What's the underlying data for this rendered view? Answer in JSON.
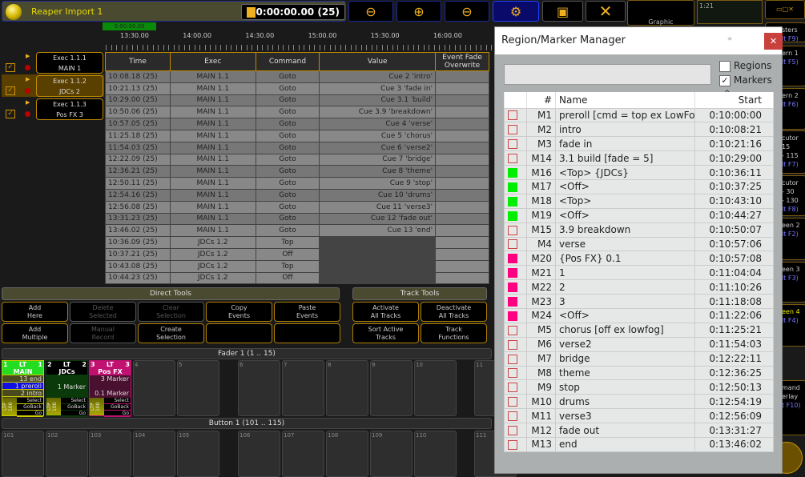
{
  "header": {
    "title": "Reaper Import 1",
    "timecode": "0:00:00.00 (25)",
    "graphic_label": "Graphic",
    "mini_label": "1:21"
  },
  "toolbar": [
    "zoom-out-icon",
    "zoom-in-icon",
    "zoom-fit-icon",
    "settings-icon",
    "view-icon",
    "close-icon"
  ],
  "timeline": {
    "playhead": "0:00:00.00",
    "labels": [
      "13:30.00",
      "14:00.00",
      "14:30.00",
      "15:00.00",
      "15:30.00",
      "16:00.00"
    ]
  },
  "tracks": [
    {
      "exec": "Exec 1.1.1",
      "name": "MAIN 1",
      "selected": false
    },
    {
      "exec": "Exec 1.1.2",
      "name": "JDCs 2",
      "selected": true
    },
    {
      "exec": "Exec 1.1.3",
      "name": "Pos FX 3",
      "selected": false
    }
  ],
  "events": {
    "headers": [
      "Time",
      "Exec",
      "Command",
      "Value",
      "Event Fade Overwrite"
    ],
    "rows": [
      [
        "10:08.18 (25)",
        "MAIN 1.1",
        "Goto",
        "Cue 2 'intro'"
      ],
      [
        "10:21.13 (25)",
        "MAIN 1.1",
        "Goto",
        "Cue 3 'fade in'"
      ],
      [
        "10:29.00 (25)",
        "MAIN 1.1",
        "Goto",
        "Cue 3.1 'build'"
      ],
      [
        "10:50.06 (25)",
        "MAIN 1.1",
        "Goto",
        "Cue 3.9 'breakdown'"
      ],
      [
        "10:57.05 (25)",
        "MAIN 1.1",
        "Goto",
        "Cue 4 'verse'"
      ],
      [
        "11:25.18 (25)",
        "MAIN 1.1",
        "Goto",
        "Cue 5 'chorus'"
      ],
      [
        "11:54.03 (25)",
        "MAIN 1.1",
        "Goto",
        "Cue 6 'verse2'"
      ],
      [
        "12:22.09 (25)",
        "MAIN 1.1",
        "Goto",
        "Cue 7 'bridge'"
      ],
      [
        "12:36.21 (25)",
        "MAIN 1.1",
        "Goto",
        "Cue 8 'theme'"
      ],
      [
        "12:50.11 (25)",
        "MAIN 1.1",
        "Goto",
        "Cue 9 'stop'"
      ],
      [
        "12:54.16 (25)",
        "MAIN 1.1",
        "Goto",
        "Cue 10 'drums'"
      ],
      [
        "12:56.08 (25)",
        "MAIN 1.1",
        "Goto",
        "Cue 11 'verse3'"
      ],
      [
        "13:31.23 (25)",
        "MAIN 1.1",
        "Goto",
        "Cue 12 'fade out'"
      ],
      [
        "13:46.02 (25)",
        "MAIN 1.1",
        "Goto",
        "Cue 13 'end'"
      ],
      [
        "10:36.09 (25)",
        "JDCs 1.2",
        "Top",
        ""
      ],
      [
        "10:37.21 (25)",
        "JDCs 1.2",
        "Off",
        ""
      ],
      [
        "10:43.08 (25)",
        "JDCs 1.2",
        "Top",
        ""
      ],
      [
        "10:44.23 (25)",
        "JDCs 1.2",
        "Off",
        ""
      ]
    ]
  },
  "direct_tools": {
    "title": "Direct Tools",
    "buttons": [
      {
        "l1": "Add",
        "l2": "Here",
        "enabled": true
      },
      {
        "l1": "Delete",
        "l2": "Selected",
        "enabled": false
      },
      {
        "l1": "Clear",
        "l2": "Selection",
        "enabled": false
      },
      {
        "l1": "Copy",
        "l2": "Events",
        "enabled": true
      },
      {
        "l1": "Paste",
        "l2": "Events",
        "enabled": true
      },
      {
        "l1": "Add",
        "l2": "Multiple",
        "enabled": true
      },
      {
        "l1": "Manual",
        "l2": "Record",
        "enabled": false
      },
      {
        "l1": "Create",
        "l2": "Selection",
        "enabled": true
      },
      {
        "l1": "",
        "l2": "",
        "enabled": true
      },
      {
        "l1": "",
        "l2": "",
        "enabled": true
      }
    ]
  },
  "track_tools": {
    "title": "Track Tools",
    "buttons": [
      {
        "l1": "Activate",
        "l2": "All Tracks"
      },
      {
        "l1": "Deactivate",
        "l2": "All Tracks"
      },
      {
        "l1": "Sort Active",
        "l2": "Tracks"
      },
      {
        "l1": "Track",
        "l2": "Functions"
      }
    ]
  },
  "fader_bar": "Fader  1 (1 .. 15)",
  "button_bar": "Button  1 (101 .. 115)",
  "faders": [
    {
      "num": "1",
      "type": "LT",
      "idx": "1",
      "name": "MAIN",
      "lines": [
        "13 end",
        "1 preroll",
        "2 intro"
      ],
      "color": "#22dd22"
    },
    {
      "num": "2",
      "type": "LT",
      "idx": "2",
      "name": "JDCs",
      "lines": [
        "1 Marker"
      ],
      "color": "#0a3a0a"
    },
    {
      "num": "3",
      "type": "LT",
      "idx": "3",
      "name": "Pos FX",
      "lines": [
        "3 Marker",
        "",
        "0.1 Marker"
      ],
      "color": "#c01070"
    }
  ],
  "fader_controls": {
    "ltp": "LTP",
    "level": "100",
    "select": "Select",
    "goback": "GoBack",
    "go": "Go"
  },
  "empty_faders": [
    "4",
    "5",
    "6",
    "7",
    "8",
    "9",
    "10",
    "11"
  ],
  "buttons": [
    "101",
    "102",
    "103",
    "104",
    "105",
    "106",
    "107",
    "108",
    "109",
    "110",
    "111"
  ],
  "right_strip": [
    {
      "a": "sters",
      "b": "lt F9)"
    },
    {
      "a": "ern 1",
      "b": "lt F5)"
    },
    {
      "a": "ern 2",
      "b": "lt F6)"
    },
    {
      "a": "cutor",
      "b": "15",
      "c": "- 115",
      "d": "lt F7)"
    },
    {
      "a": "cutor",
      "b": "- 30",
      "c": "- 130",
      "d": "lt F8)"
    },
    {
      "a": "een 2",
      "b": "lt F2)"
    },
    {
      "a": "een 3",
      "b": "lt F3)"
    },
    {
      "a": "een 4",
      "b": "lt F4)"
    },
    {
      "a": "mand",
      "b": "erlay",
      "c": "t F10)"
    }
  ],
  "dialog": {
    "title": "Region/Marker Manager",
    "search_value": "",
    "regions_label": "Regions",
    "regions_checked": false,
    "markers_label": "Markers",
    "markers_checked": true,
    "headers": {
      "num": "#",
      "name": "Name",
      "start": "Start"
    },
    "markers": [
      {
        "id": "M1",
        "name": "preroll [cmd = top ex LowFog]",
        "start": "0:10:00:00",
        "color": ""
      },
      {
        "id": "M2",
        "name": "intro",
        "start": "0:10:08:21",
        "color": ""
      },
      {
        "id": "M3",
        "name": "fade in",
        "start": "0:10:21:16",
        "color": ""
      },
      {
        "id": "M14",
        "name": "3.1 build [fade = 5]",
        "start": "0:10:29:00",
        "color": ""
      },
      {
        "id": "M16",
        "name": "<Top> {JDCs}",
        "start": "0:10:36:11",
        "color": "#00ee00"
      },
      {
        "id": "M17",
        "name": "<Off>",
        "start": "0:10:37:25",
        "color": "#00ee00"
      },
      {
        "id": "M18",
        "name": "<Top>",
        "start": "0:10:43:10",
        "color": "#00ee00"
      },
      {
        "id": "M19",
        "name": "<Off>",
        "start": "0:10:44:27",
        "color": "#00ee00"
      },
      {
        "id": "M15",
        "name": "3.9 breakdown",
        "start": "0:10:50:07",
        "color": ""
      },
      {
        "id": "M4",
        "name": "verse",
        "start": "0:10:57:06",
        "color": ""
      },
      {
        "id": "M20",
        "name": "{Pos FX} 0.1",
        "start": "0:10:57:08",
        "color": "#ff0080"
      },
      {
        "id": "M21",
        "name": "1",
        "start": "0:11:04:04",
        "color": "#ff0080"
      },
      {
        "id": "M22",
        "name": "2",
        "start": "0:11:10:26",
        "color": "#ff0080"
      },
      {
        "id": "M23",
        "name": "3",
        "start": "0:11:18:08",
        "color": "#ff0080"
      },
      {
        "id": "M24",
        "name": "<Off>",
        "start": "0:11:22:06",
        "color": "#ff0080"
      },
      {
        "id": "M5",
        "name": "chorus [off ex lowfog]",
        "start": "0:11:25:21",
        "color": ""
      },
      {
        "id": "M6",
        "name": "verse2",
        "start": "0:11:54:03",
        "color": ""
      },
      {
        "id": "M7",
        "name": "bridge",
        "start": "0:12:22:11",
        "color": ""
      },
      {
        "id": "M8",
        "name": "theme",
        "start": "0:12:36:25",
        "color": ""
      },
      {
        "id": "M9",
        "name": "stop",
        "start": "0:12:50:13",
        "color": ""
      },
      {
        "id": "M10",
        "name": "drums",
        "start": "0:12:54:19",
        "color": ""
      },
      {
        "id": "M11",
        "name": "verse3",
        "start": "0:12:56:09",
        "color": ""
      },
      {
        "id": "M12",
        "name": "fade out",
        "start": "0:13:31:27",
        "color": ""
      },
      {
        "id": "M13",
        "name": "end",
        "start": "0:13:46:02",
        "color": ""
      }
    ]
  }
}
